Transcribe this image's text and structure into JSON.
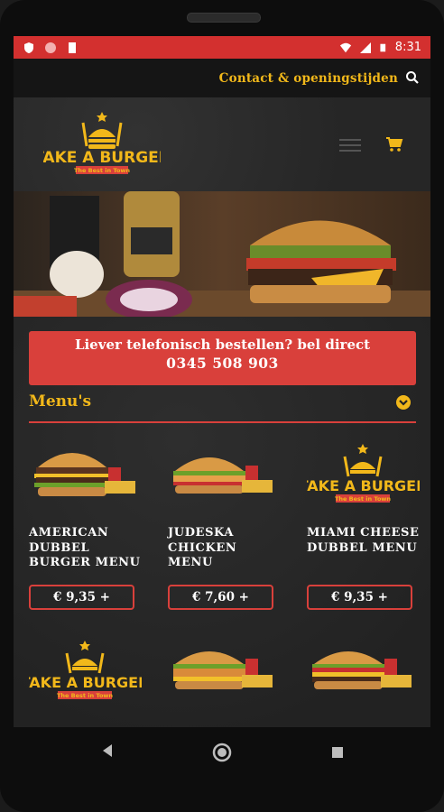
{
  "status_bar": {
    "time": "8:31"
  },
  "topbar": {
    "contact_link": "Contact & openingstijden"
  },
  "logo": {
    "brand": "TAKE A BURGER",
    "tagline": "The Best in Town"
  },
  "call_banner": {
    "line1": "Liever telefonisch bestellen? bel direct",
    "line2": "0345 508 903"
  },
  "menu_section": {
    "title": "Menu's"
  },
  "menu_items": [
    {
      "name": "AMERICAN DUBBEL BURGER MENU",
      "price": "€ 9,35 +",
      "image": "burger-double-photo"
    },
    {
      "name": "JUDESKA CHICKEN MENU",
      "price": "€ 7,60 +",
      "image": "chicken-burger-photo"
    },
    {
      "name": "MIAMI CHEESE DUBBEL MENU",
      "price": "€ 9,35 +",
      "image": "take-a-burger-logo"
    },
    {
      "name": "",
      "price": "",
      "image": "take-a-burger-logo"
    },
    {
      "name": "",
      "price": "",
      "image": "crispy-burger-photo"
    },
    {
      "name": "",
      "price": "",
      "image": "cheese-burger-photo"
    }
  ],
  "colors": {
    "accent_yellow": "#f2b81a",
    "accent_red": "#d9403b",
    "status_red": "#d3302f"
  }
}
